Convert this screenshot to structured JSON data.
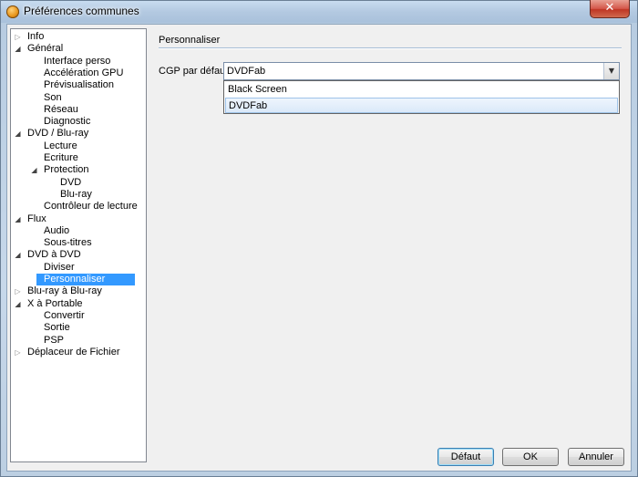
{
  "window": {
    "title": "Préférences communes",
    "close_glyph": "✕"
  },
  "tree": [
    {
      "label": "Info",
      "level": 0,
      "expander": "collapsed"
    },
    {
      "label": "Général",
      "level": 0,
      "expander": "expanded"
    },
    {
      "label": "Interface perso",
      "level": 1,
      "expander": "none"
    },
    {
      "label": "Accélération GPU",
      "level": 1,
      "expander": "none"
    },
    {
      "label": "Prévisualisation",
      "level": 1,
      "expander": "none"
    },
    {
      "label": "Son",
      "level": 1,
      "expander": "none"
    },
    {
      "label": "Réseau",
      "level": 1,
      "expander": "none"
    },
    {
      "label": "Diagnostic",
      "level": 1,
      "expander": "none"
    },
    {
      "label": "DVD / Blu-ray",
      "level": 0,
      "expander": "expanded"
    },
    {
      "label": "Lecture",
      "level": 1,
      "expander": "none"
    },
    {
      "label": "Ecriture",
      "level": 1,
      "expander": "none"
    },
    {
      "label": "Protection",
      "level": 1,
      "expander": "expanded"
    },
    {
      "label": "DVD",
      "level": 2,
      "expander": "none"
    },
    {
      "label": "Blu-ray",
      "level": 2,
      "expander": "none"
    },
    {
      "label": "Contrôleur de lecture",
      "level": 1,
      "expander": "none"
    },
    {
      "label": "Flux",
      "level": 0,
      "expander": "expanded"
    },
    {
      "label": "Audio",
      "level": 1,
      "expander": "none"
    },
    {
      "label": "Sous-titres",
      "level": 1,
      "expander": "none"
    },
    {
      "label": "DVD à DVD",
      "level": 0,
      "expander": "expanded"
    },
    {
      "label": "Diviser",
      "level": 1,
      "expander": "none"
    },
    {
      "label": "Personnaliser",
      "level": 1,
      "expander": "none",
      "selected": true
    },
    {
      "label": "Blu-ray à Blu-ray",
      "level": 0,
      "expander": "collapsed"
    },
    {
      "label": "X à Portable",
      "level": 0,
      "expander": "expanded"
    },
    {
      "label": "Convertir",
      "level": 1,
      "expander": "none"
    },
    {
      "label": "Sortie",
      "level": 1,
      "expander": "none"
    },
    {
      "label": "PSP",
      "level": 1,
      "expander": "none"
    },
    {
      "label": "Déplaceur de Fichier",
      "level": 0,
      "expander": "collapsed"
    }
  ],
  "panel": {
    "section_title": "Personnaliser",
    "field_label": "CGP par défaut",
    "combo_value": "DVDFab",
    "options": [
      {
        "label": "Black Screen",
        "highlighted": false
      },
      {
        "label": "DVDFab",
        "highlighted": true
      }
    ]
  },
  "buttons": {
    "default": "Défaut",
    "ok": "OK",
    "cancel": "Annuler"
  },
  "icons": {
    "expanded": "◢",
    "collapsed": "▷",
    "dropdown": "▼"
  }
}
